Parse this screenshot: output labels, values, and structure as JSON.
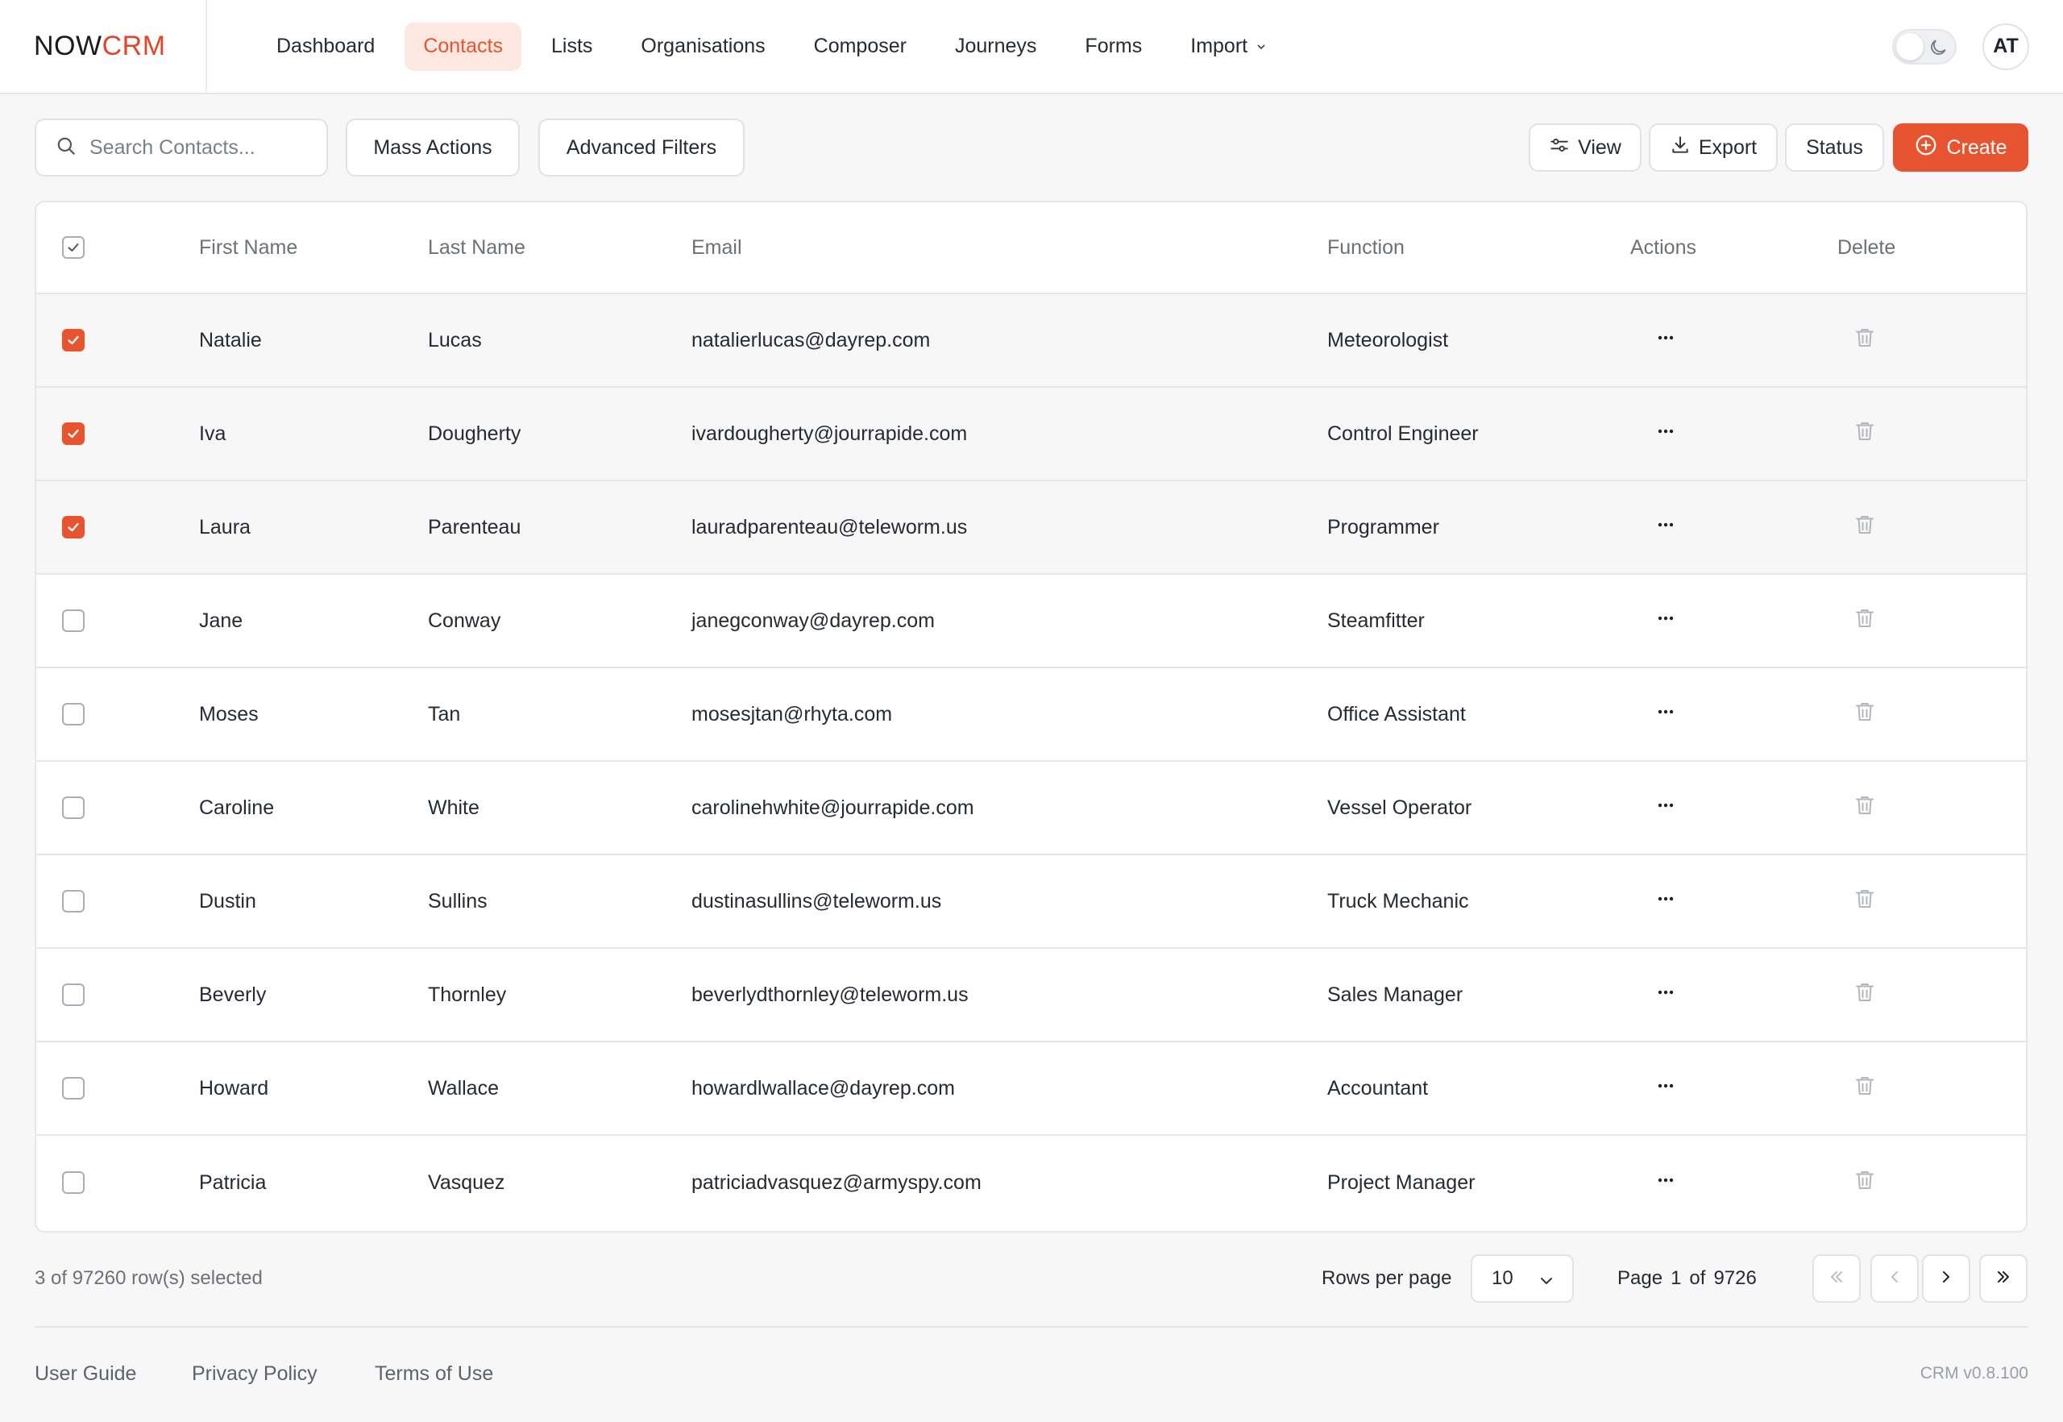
{
  "app": {
    "logo_now": "NOW",
    "logo_crm": "CRM",
    "accent_color": "#e8542f"
  },
  "nav": {
    "items": [
      {
        "label": "Dashboard",
        "active": false
      },
      {
        "label": "Contacts",
        "active": true
      },
      {
        "label": "Lists",
        "active": false
      },
      {
        "label": "Organisations",
        "active": false
      },
      {
        "label": "Composer",
        "active": false
      },
      {
        "label": "Journeys",
        "active": false
      },
      {
        "label": "Forms",
        "active": false
      },
      {
        "label": "Import",
        "active": false
      }
    ]
  },
  "user": {
    "initials": "AT",
    "theme_toggle": "moon-icon"
  },
  "toolbar": {
    "search_placeholder": "Search Contacts...",
    "mass_actions": "Mass Actions",
    "advanced_filters": "Advanced Filters",
    "view": "View",
    "export": "Export",
    "status": "Status",
    "create": "Create"
  },
  "table": {
    "columns": {
      "first": "First Name",
      "last": "Last Name",
      "email": "Email",
      "function": "Function",
      "actions": "Actions",
      "delete": "Delete"
    },
    "rows": [
      {
        "first": "Natalie",
        "last": "Lucas",
        "email": "natalierlucas@dayrep.com",
        "function": "Meteorologist",
        "selected": true
      },
      {
        "first": "Iva",
        "last": "Dougherty",
        "email": "ivardougherty@jourrapide.com",
        "function": "Control Engineer",
        "selected": true
      },
      {
        "first": "Laura",
        "last": "Parenteau",
        "email": "lauradparenteau@teleworm.us",
        "function": "Programmer",
        "selected": true
      },
      {
        "first": "Jane",
        "last": "Conway",
        "email": "janegconway@dayrep.com",
        "function": "Steamfitter",
        "selected": false
      },
      {
        "first": "Moses",
        "last": "Tan",
        "email": "mosesjtan@rhyta.com",
        "function": "Office Assistant",
        "selected": false
      },
      {
        "first": "Caroline",
        "last": "White",
        "email": "carolinehwhite@jourrapide.com",
        "function": "Vessel Operator",
        "selected": false
      },
      {
        "first": "Dustin",
        "last": "Sullins",
        "email": "dustinasullins@teleworm.us",
        "function": "Truck Mechanic",
        "selected": false
      },
      {
        "first": "Beverly",
        "last": "Thornley",
        "email": "beverlydthornley@teleworm.us",
        "function": "Sales Manager",
        "selected": false
      },
      {
        "first": "Howard",
        "last": "Wallace",
        "email": "howardlwallace@dayrep.com",
        "function": "Accountant",
        "selected": false
      },
      {
        "first": "Patricia",
        "last": "Vasquez",
        "email": "patriciadvasquez@armyspy.com",
        "function": "Project Manager",
        "selected": false
      }
    ]
  },
  "pagination": {
    "selected_text": "3 of 97260 row(s) selected",
    "rows_per_page_label": "Rows per page",
    "rows_per_page": "10",
    "page_label": "Page",
    "page_current": "1",
    "page_of": "of",
    "page_total": "9726"
  },
  "footer": {
    "user_guide": "User Guide",
    "privacy": "Privacy Policy",
    "terms": "Terms of Use",
    "version": "CRM v0.8.100"
  }
}
